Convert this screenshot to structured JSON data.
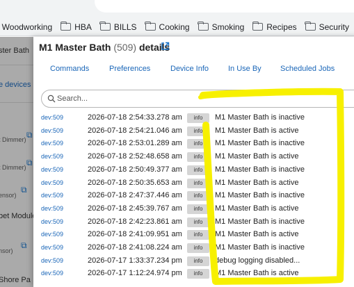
{
  "browser": {
    "bookmarks": [
      {
        "label": "A Woodworking",
        "folder": false
      },
      {
        "label": "HBA",
        "folder": true
      },
      {
        "label": "BILLS",
        "folder": true
      },
      {
        "label": "Cooking",
        "folder": true
      },
      {
        "label": "Smoking",
        "folder": true
      },
      {
        "label": "Recipes",
        "folder": true
      },
      {
        "label": "Security",
        "folder": true
      }
    ]
  },
  "background_page": {
    "items": [
      "ster Bath",
      "e devices",
      "t Dimmer)",
      "t Dimmer)",
      "ensor)",
      "bet Module",
      "nsor)",
      "Shore Pa"
    ]
  },
  "dialog": {
    "title_name": "M1 Master Bath",
    "title_count": "(509)",
    "title_suffix": "details",
    "tabs": [
      "Commands",
      "Preferences",
      "Device Info",
      "In Use By",
      "Scheduled Jobs"
    ],
    "search_placeholder": "Search..."
  },
  "log_entries": [
    {
      "dev": "dev:509",
      "time": "2026-07-18 2:54:33.278 am",
      "level": "info",
      "msg": "M1 Master Bath is inactive"
    },
    {
      "dev": "dev:509",
      "time": "2026-07-18 2:54:21.046 am",
      "level": "info",
      "msg": "M1 Master Bath is active"
    },
    {
      "dev": "dev:509",
      "time": "2026-07-18 2:53:01.289 am",
      "level": "info",
      "msg": "M1 Master Bath is inactive"
    },
    {
      "dev": "dev:509",
      "time": "2026-07-18 2:52:48.658 am",
      "level": "info",
      "msg": "M1 Master Bath is active"
    },
    {
      "dev": "dev:509",
      "time": "2026-07-18 2:50:49.377 am",
      "level": "info",
      "msg": "M1 Master Bath is inactive"
    },
    {
      "dev": "dev:509",
      "time": "2026-07-18 2:50:35.653 am",
      "level": "info",
      "msg": "M1 Master Bath is active"
    },
    {
      "dev": "dev:509",
      "time": "2026-07-18 2:47:37.446 am",
      "level": "info",
      "msg": "M1 Master Bath is inactive"
    },
    {
      "dev": "dev:509",
      "time": "2026-07-18 2:45:39.767 am",
      "level": "info",
      "msg": "M1 Master Bath is active"
    },
    {
      "dev": "dev:509",
      "time": "2026-07-18 2:42:23.861 am",
      "level": "info",
      "msg": "M1 Master Bath is inactive"
    },
    {
      "dev": "dev:509",
      "time": "2026-07-18 2:41:09.951 am",
      "level": "info",
      "msg": "M1 Master Bath is active"
    },
    {
      "dev": "dev:509",
      "time": "2026-07-18 2:41:08.224 am",
      "level": "info",
      "msg": "M1 Master Bath is inactive"
    },
    {
      "dev": "dev:509",
      "time": "2026-07-17 1:33:37.234 pm",
      "level": "info",
      "msg": "debug logging disabled..."
    },
    {
      "dev": "dev:509",
      "time": "2026-07-17 1:12:24.974 pm",
      "level": "info",
      "msg": "M1 Master Bath is active"
    }
  ],
  "annotation": {
    "color": "#f7f000"
  }
}
